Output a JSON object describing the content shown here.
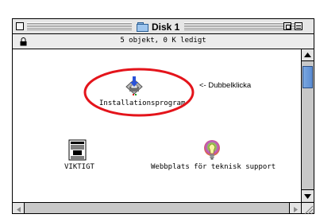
{
  "window": {
    "title": "Disk 1",
    "status": "5 objekt, 0 K ledigt"
  },
  "icons": [
    {
      "label": "Installationsprogram",
      "icon": "installer-icon"
    },
    {
      "label": "VIKTIGT",
      "icon": "document-icon"
    },
    {
      "label": "Webbplats för teknisk support",
      "icon": "lightbulb-icon"
    }
  ],
  "annotation": {
    "text": "<- Dubbelklicka",
    "circle_color": "#e4141b"
  }
}
